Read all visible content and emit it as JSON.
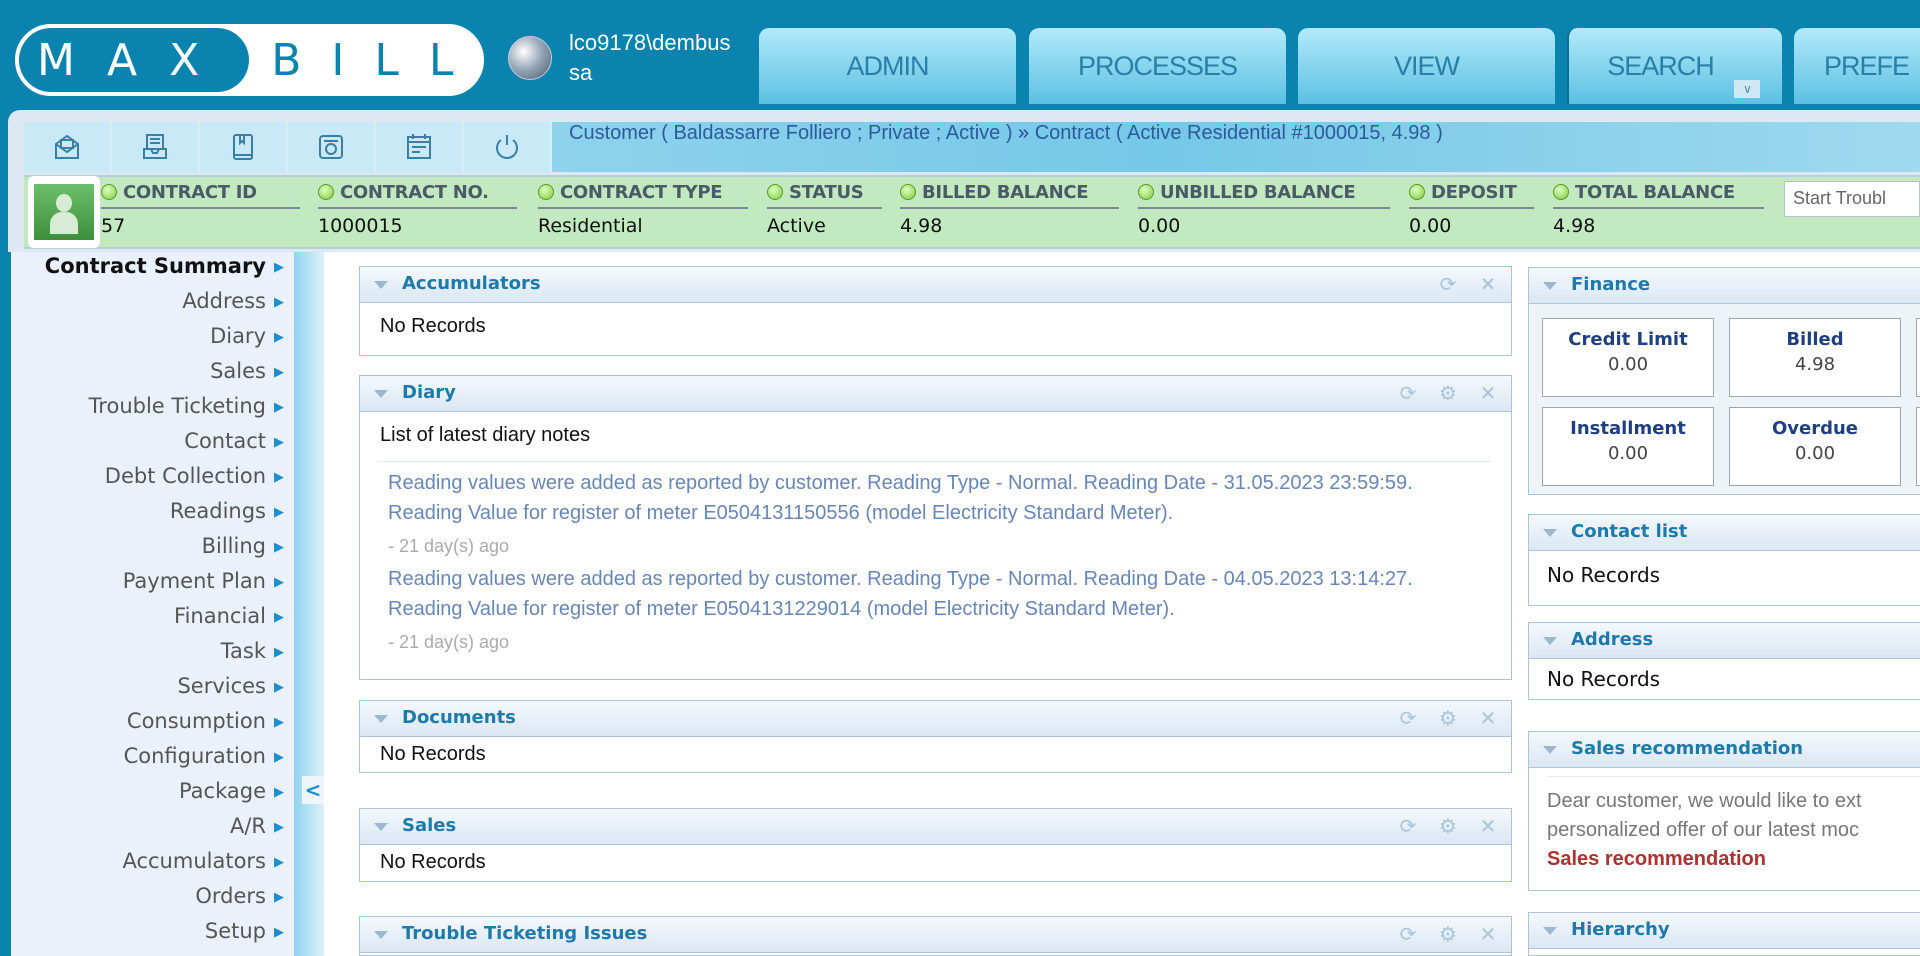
{
  "header": {
    "logo_left": "MAX",
    "logo_right": "BILL",
    "user_line1": "lco9178\\dembus",
    "user_line2": "sa",
    "tabs": [
      {
        "label": "ADMIN"
      },
      {
        "label": "PROCESSES"
      },
      {
        "label": "VIEW"
      },
      {
        "label": "SEARCH"
      },
      {
        "label": "PREFE"
      }
    ]
  },
  "toolbar": {
    "icons": [
      "mail-open-icon",
      "inbox-icon",
      "book-icon",
      "camera-icon",
      "calendar-icon",
      "power-icon"
    ],
    "breadcrumb_customer": "Customer ( Baldassarre Folliero ; Private ; Active )",
    "breadcrumb_separator": "»",
    "breadcrumb_contract": "Contract ( Active Residential #1000015, 4.98 )"
  },
  "contract_bar": {
    "fields": [
      {
        "label": "CONTRACT ID",
        "value": "57"
      },
      {
        "label": "CONTRACT NO.",
        "value": "1000015"
      },
      {
        "label": "CONTRACT TYPE",
        "value": "Residential"
      },
      {
        "label": "STATUS",
        "value": "Active"
      },
      {
        "label": "BILLED BALANCE",
        "value": "4.98"
      },
      {
        "label": "UNBILLED BALANCE",
        "value": "0.00"
      },
      {
        "label": "DEPOSIT",
        "value": "0.00"
      },
      {
        "label": "TOTAL BALANCE",
        "value": "4.98"
      }
    ],
    "trouble_placeholder": "Start Troubl",
    "status_color": "#7bcc3a"
  },
  "nav": {
    "items": [
      {
        "label": "Contract Summary"
      },
      {
        "label": "Address"
      },
      {
        "label": "Diary"
      },
      {
        "label": "Sales"
      },
      {
        "label": "Trouble Ticketing"
      },
      {
        "label": "Contact"
      },
      {
        "label": "Debt Collection"
      },
      {
        "label": "Readings"
      },
      {
        "label": "Billing"
      },
      {
        "label": "Payment Plan"
      },
      {
        "label": "Financial"
      },
      {
        "label": "Task"
      },
      {
        "label": "Services"
      },
      {
        "label": "Consumption"
      },
      {
        "label": "Configuration"
      },
      {
        "label": "Package"
      },
      {
        "label": "A/R"
      },
      {
        "label": "Accumulators"
      },
      {
        "label": "Orders"
      },
      {
        "label": "Setup"
      }
    ],
    "collapse": "<"
  },
  "widgets": {
    "no_records": "No Records",
    "accumulators": {
      "title": "Accumulators"
    },
    "diary": {
      "title": "Diary",
      "intro": "List of latest diary notes",
      "notes": [
        {
          "text": "Reading values were added as reported by customer. Reading Type - Normal. Reading Date - 31.05.2023 23:59:59. Reading Value for register of meter E0504131150556 (model Electricity Standard Meter).",
          "ago": "- 21 day(s) ago"
        },
        {
          "text": "Reading values were added as reported by customer. Reading Type - Normal. Reading Date - 04.05.2023 13:14:27. Reading Value for register of meter E0504131229014 (model Electricity Standard Meter).",
          "ago": "- 21 day(s) ago"
        }
      ]
    },
    "documents": {
      "title": "Documents"
    },
    "sales": {
      "title": "Sales"
    },
    "trouble": {
      "title": "Trouble Ticketing Issues"
    },
    "finance": {
      "title": "Finance",
      "cards": [
        {
          "title": "Credit Limit",
          "value": "0.00"
        },
        {
          "title": "Billed",
          "value": "4.98"
        },
        {
          "title": "Installment",
          "value": "0.00"
        },
        {
          "title": "Overdue",
          "value": "0.00"
        }
      ]
    },
    "contact_list": {
      "title": "Contact list"
    },
    "address": {
      "title": "Address"
    },
    "sales_rec": {
      "title": "Sales recommendation",
      "line1": "Dear customer, we would like to ext",
      "line2": "personalized offer of our latest moc",
      "link": "Sales recommendation",
      "link_color": "#b03030"
    },
    "hierarchy": {
      "title": "Hierarchy"
    }
  }
}
